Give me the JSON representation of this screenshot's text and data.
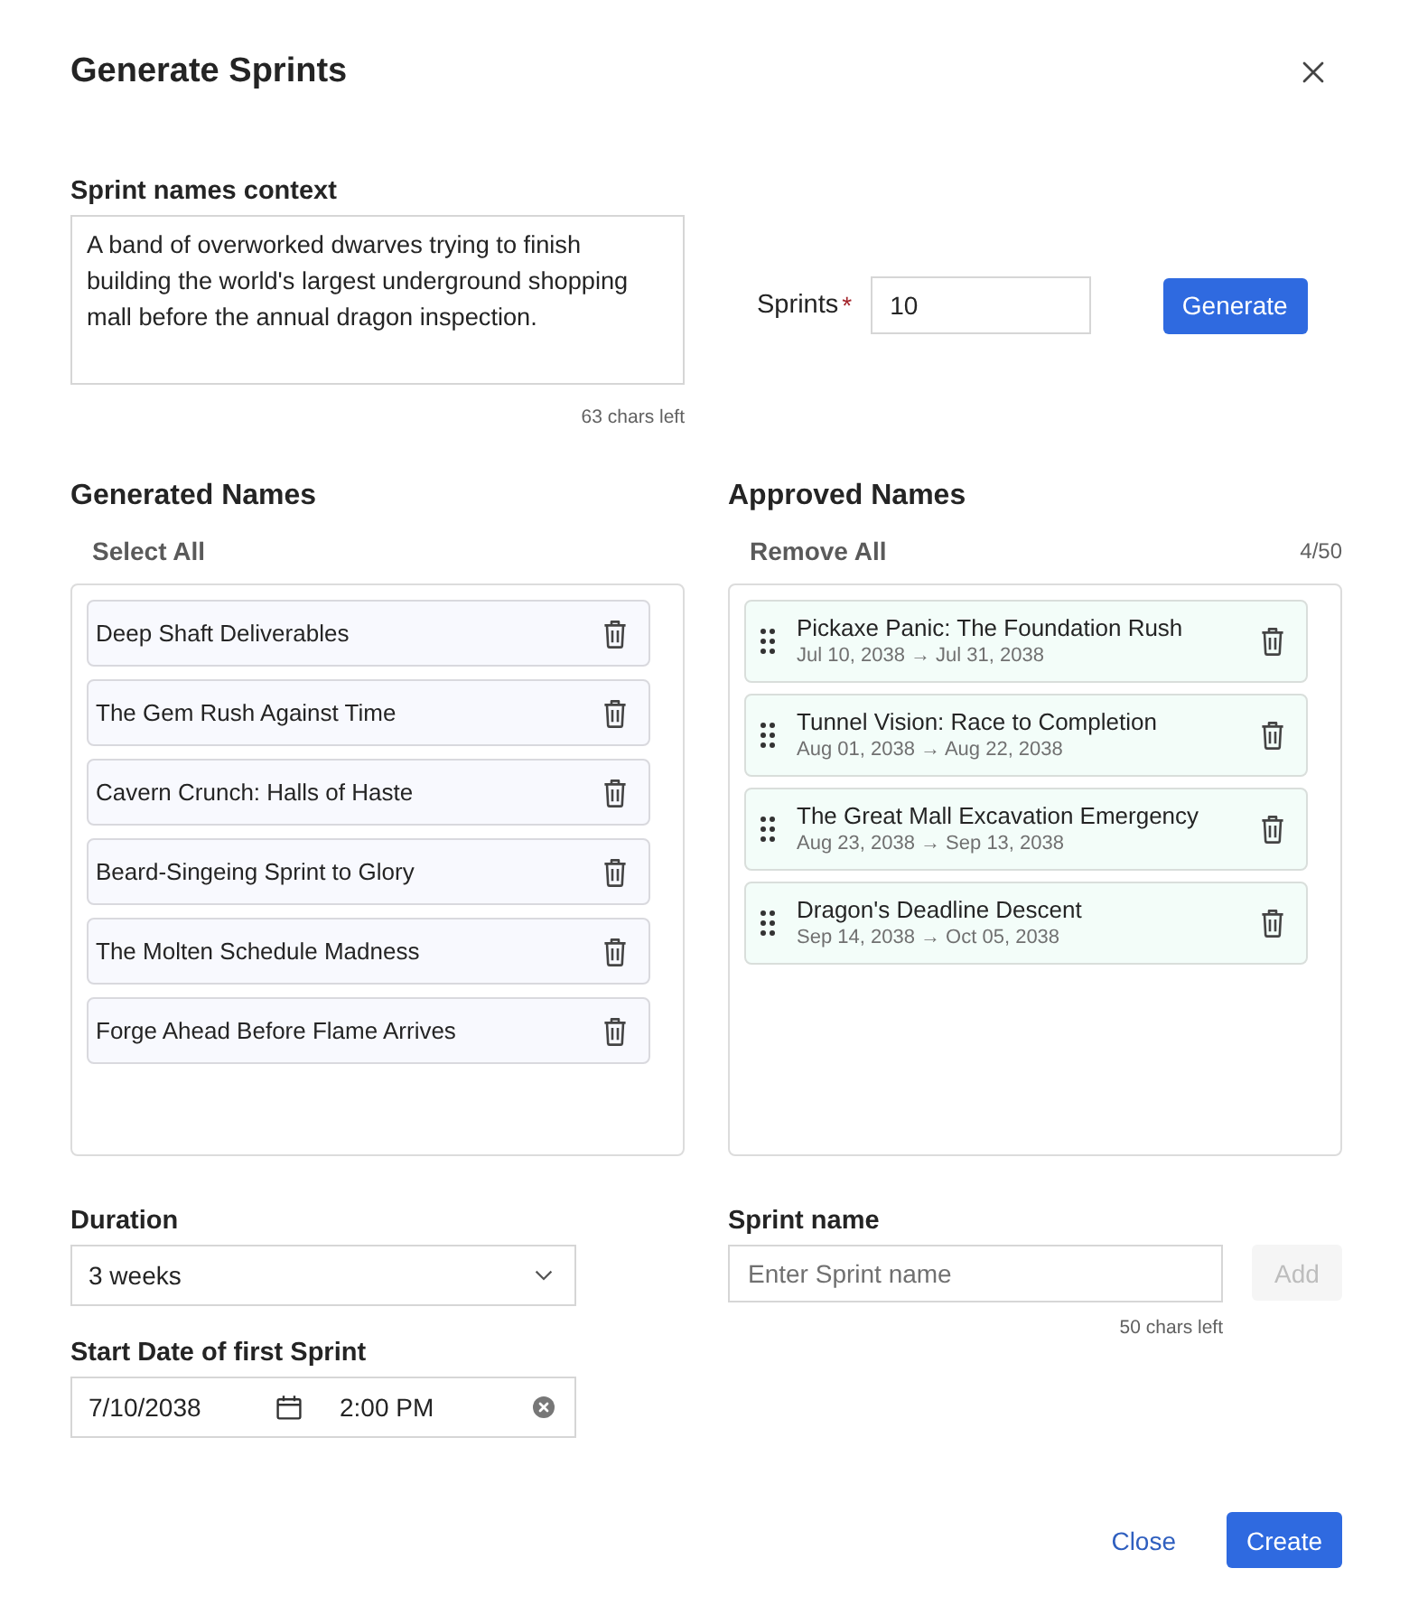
{
  "dialog": {
    "title": "Generate Sprints"
  },
  "context": {
    "label": "Sprint names context",
    "value": "A band of overworked dwarves trying to finish building the world's largest underground shopping mall before the annual dragon inspection.",
    "counter": "63 chars left"
  },
  "sprints": {
    "label": "Sprints",
    "required_mark": "*",
    "value": "10",
    "button": "Generate"
  },
  "generated": {
    "heading": "Generated Names",
    "action": "Select All",
    "items": [
      "Deep Shaft Deliverables",
      "The Gem Rush Against Time",
      "Cavern Crunch: Halls of Haste",
      "Beard-Singeing Sprint to Glory",
      "The Molten Schedule Madness",
      "Forge Ahead Before Flame Arrives"
    ]
  },
  "approved": {
    "heading": "Approved Names",
    "action": "Remove All",
    "count": "4/50",
    "items": [
      {
        "name": "Pickaxe Panic: The Foundation Rush",
        "dates": "Jul 10, 2038 → Jul 31, 2038"
      },
      {
        "name": "Tunnel Vision: Race to Completion",
        "dates": "Aug 01, 2038 → Aug 22, 2038"
      },
      {
        "name": "The Great Mall Excavation Emergency",
        "dates": "Aug 23, 2038 → Sep 13, 2038"
      },
      {
        "name": "Dragon's Deadline Descent",
        "dates": "Sep 14, 2038 → Oct 05, 2038"
      }
    ]
  },
  "duration": {
    "label": "Duration",
    "value": "3 weeks"
  },
  "start_date": {
    "label": "Start Date of first Sprint",
    "date": "7/10/2038",
    "time": "2:00 PM"
  },
  "sprint_name": {
    "label": "Sprint name",
    "placeholder": "Enter Sprint name",
    "counter": "50 chars left",
    "add_button": {
      "label": "Add",
      "disabled": true
    }
  },
  "footer": {
    "buttons": [
      {
        "label": "Close",
        "kind": "link"
      },
      {
        "label": "Create",
        "kind": "primary"
      }
    ]
  }
}
